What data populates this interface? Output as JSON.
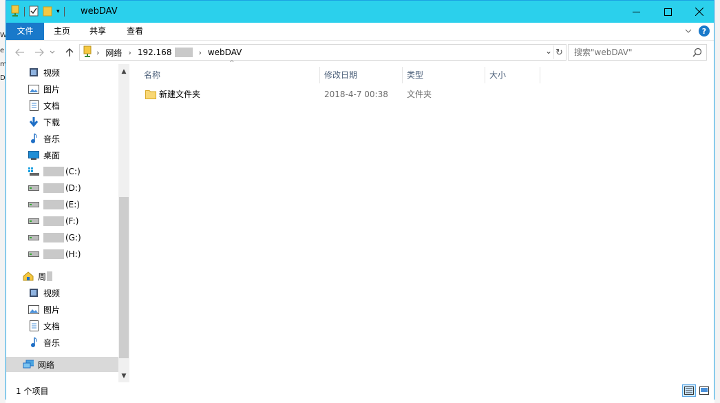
{
  "window": {
    "title": "webDAV"
  },
  "desktop_edge_letters": [
    "W",
    "e",
    "m",
    "D"
  ],
  "ribbon": {
    "tabs": [
      "文件",
      "主页",
      "共享",
      "查看"
    ]
  },
  "address_bar": {
    "crumbs": [
      "网络",
      "192.168",
      "webDAV"
    ]
  },
  "search": {
    "placeholder": "搜索\"webDAV\""
  },
  "nav_pane": {
    "items": [
      {
        "label": "视频",
        "icon": "video-icon"
      },
      {
        "label": "图片",
        "icon": "pictures-icon"
      },
      {
        "label": "文档",
        "icon": "documents-icon"
      },
      {
        "label": "下载",
        "icon": "download-icon"
      },
      {
        "label": "音乐",
        "icon": "music-icon"
      },
      {
        "label": "桌面",
        "icon": "desktop-icon"
      },
      {
        "label": "(C:)",
        "icon": "system-drive-icon"
      },
      {
        "label": "(D:)",
        "icon": "drive-icon"
      },
      {
        "label": "(E:)",
        "icon": "drive-icon"
      },
      {
        "label": "(F:)",
        "icon": "drive-icon"
      },
      {
        "label": "(G:)",
        "icon": "drive-icon"
      },
      {
        "label": "(H:)",
        "icon": "drive-icon"
      },
      {
        "label": "周",
        "icon": "homegroup-icon"
      },
      {
        "label": "视频",
        "icon": "video-icon"
      },
      {
        "label": "图片",
        "icon": "pictures-icon"
      },
      {
        "label": "文档",
        "icon": "documents-icon"
      },
      {
        "label": "音乐",
        "icon": "music-icon"
      },
      {
        "label": "网络",
        "icon": "network-icon"
      }
    ]
  },
  "file_list": {
    "columns": [
      "名称",
      "修改日期",
      "类型",
      "大小"
    ],
    "rows": [
      {
        "name": "新建文件夹",
        "modified": "2018-4-7 00:38",
        "type": "文件夹",
        "size": ""
      }
    ]
  },
  "status_bar": {
    "text": "1 个项目"
  },
  "colors": {
    "titlebar": "#2bd0ec",
    "file_tab": "#1979ca",
    "selection": "#d9d9d9"
  }
}
